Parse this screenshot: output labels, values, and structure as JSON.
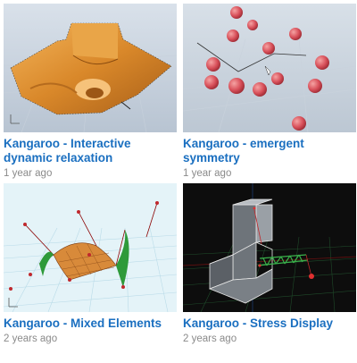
{
  "videos": [
    {
      "title": "Kangaroo - Interactive dynamic relaxation",
      "age": "1 year ago",
      "thumbnail": "orange-relaxed-surface"
    },
    {
      "title": "Kangaroo - emergent symmetry",
      "age": "1 year ago",
      "thumbnail": "red-spheres-particles"
    },
    {
      "title": "Kangaroo - Mixed Elements",
      "age": "2 years ago",
      "thumbnail": "hypar-mesh-with-arches"
    },
    {
      "title": "Kangaroo - Stress Display",
      "age": "2 years ago",
      "thumbnail": "box-and-truss-stress"
    }
  ]
}
